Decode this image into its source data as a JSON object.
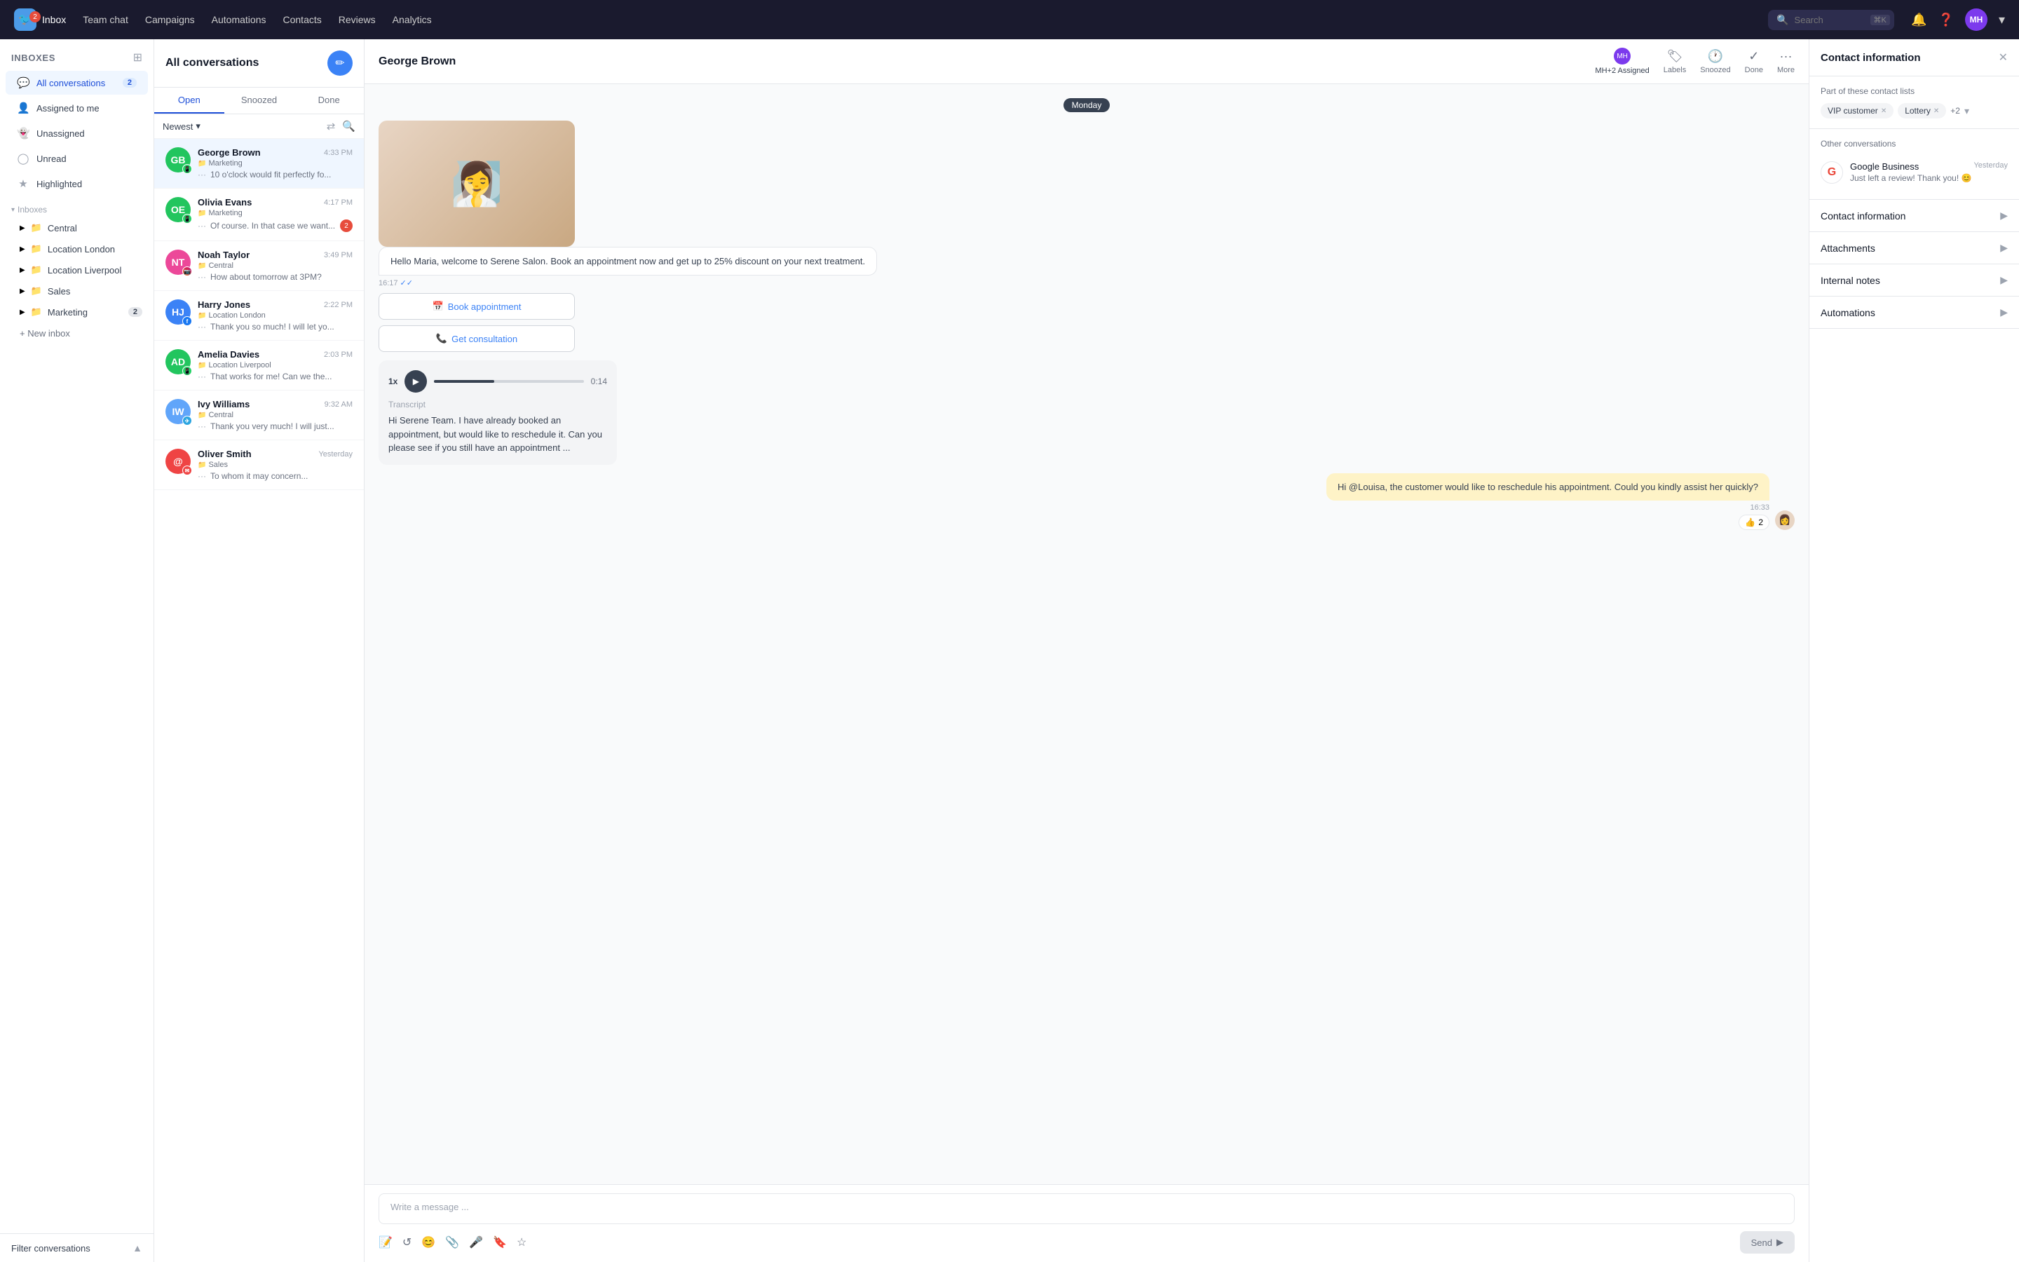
{
  "topnav": {
    "logo_badge": "2",
    "inbox_label": "Inbox",
    "nav_items": [
      "Team chat",
      "Campaigns",
      "Automations",
      "Contacts",
      "Reviews",
      "Analytics"
    ],
    "search_placeholder": "Search",
    "search_shortcut": "⌘K",
    "user_initials": "MH"
  },
  "sidebar": {
    "title": "Inboxes",
    "items": [
      {
        "label": "All conversations",
        "badge": "2",
        "active": true
      },
      {
        "label": "Assigned to me",
        "badge": ""
      },
      {
        "label": "Unassigned",
        "badge": ""
      },
      {
        "label": "Unread",
        "badge": ""
      },
      {
        "label": "Highlighted",
        "badge": ""
      }
    ],
    "inboxes_section": "Inboxes",
    "folders": [
      {
        "label": "Central",
        "badge": ""
      },
      {
        "label": "Location London",
        "badge": ""
      },
      {
        "label": "Location Liverpool",
        "badge": ""
      },
      {
        "label": "Sales",
        "badge": ""
      },
      {
        "label": "Marketing",
        "badge": "2"
      }
    ],
    "new_inbox_label": "+ New inbox",
    "filter_label": "Filter conversations",
    "filter_arrow": "▲"
  },
  "conversations": {
    "header": "All conversations",
    "compose_icon": "✏",
    "tabs": [
      "Open",
      "Snoozed",
      "Done"
    ],
    "active_tab": "Open",
    "filter_label": "Newest",
    "items": [
      {
        "name": "George Brown",
        "inbox": "Marketing",
        "time": "4:33 PM",
        "preview": "10 o'clock would fit perfectly fo...",
        "avatar_color": "#22c55e",
        "initials": "GB",
        "platform": "whatsapp",
        "active": true,
        "unread": 0
      },
      {
        "name": "Olivia Evans",
        "inbox": "Marketing",
        "time": "4:17 PM",
        "preview": "Of course. In that case we want...",
        "avatar_color": "#22c55e",
        "initials": "OE",
        "platform": "whatsapp",
        "active": false,
        "unread": 2
      },
      {
        "name": "Noah Taylor",
        "inbox": "Central",
        "time": "3:49 PM",
        "preview": "How about tomorrow at 3PM?",
        "avatar_color": "#ec4899",
        "initials": "NT",
        "platform": "instagram",
        "active": false,
        "unread": 0
      },
      {
        "name": "Harry Jones",
        "inbox": "Location London",
        "time": "2:22 PM",
        "preview": "Thank you so much! I will let yo...",
        "avatar_color": "#3b82f6",
        "initials": "HJ",
        "platform": "facebook",
        "active": false,
        "unread": 0
      },
      {
        "name": "Amelia Davies",
        "inbox": "Location Liverpool",
        "time": "2:03 PM",
        "preview": "That works for me! Can we the...",
        "avatar_color": "#22c55e",
        "initials": "AD",
        "platform": "whatsapp",
        "active": false,
        "unread": 0
      },
      {
        "name": "Ivy Williams",
        "inbox": "Central",
        "time": "9:32 AM",
        "preview": "Thank you very much! I will just...",
        "avatar_color": "#60a5fa",
        "initials": "IW",
        "platform": "telegram",
        "active": false,
        "unread": 0
      },
      {
        "name": "Oliver Smith",
        "inbox": "Sales",
        "time": "Yesterday",
        "preview": "To whom it may concern...",
        "avatar_color": "#ef4444",
        "initials": "OS",
        "platform": "email",
        "active": false,
        "unread": 0
      }
    ]
  },
  "chat": {
    "title": "George Brown",
    "date_divider": "Monday",
    "assigned_label": "Assigned",
    "assigned_initials": "MH+2",
    "labels_label": "Labels",
    "snoozed_label": "Snoozed",
    "done_label": "Done",
    "more_label": "More",
    "welcome_message": "Hello Maria, welcome to Serene Salon. Book an appointment now and get up to 25% discount on your next treatment.",
    "welcome_time": "16:17",
    "book_appointment_btn": "📅 Book appointment",
    "get_consultation_btn": "📞 Get consultation",
    "audio_speed": "1x",
    "audio_duration": "0:14",
    "transcript_label": "Transcript",
    "transcript_text": "Hi Serene Team. I have already booked an appointment, but would like to reschedule it. Can you please see if you still have an appointment ...",
    "outgoing_message": "Hi @Louisa, the customer would like to reschedule his appointment. Could you kindly assist her quickly?",
    "outgoing_time": "16:33",
    "reaction_emoji": "👍",
    "reaction_count": "2",
    "input_placeholder": "Write a message ...",
    "send_btn": "Send"
  },
  "right_panel": {
    "title": "Contact information",
    "contact_lists_label": "Part of these contact lists",
    "tags": [
      "VIP customer",
      "Lottery",
      "+2"
    ],
    "other_convs_label": "Other conversations",
    "other_conv": {
      "source": "Google Business",
      "time": "Yesterday",
      "preview": "Just left a review! Thank you! 😊"
    },
    "sections": [
      "Contact information",
      "Attachments",
      "Internal notes",
      "Automations"
    ]
  }
}
